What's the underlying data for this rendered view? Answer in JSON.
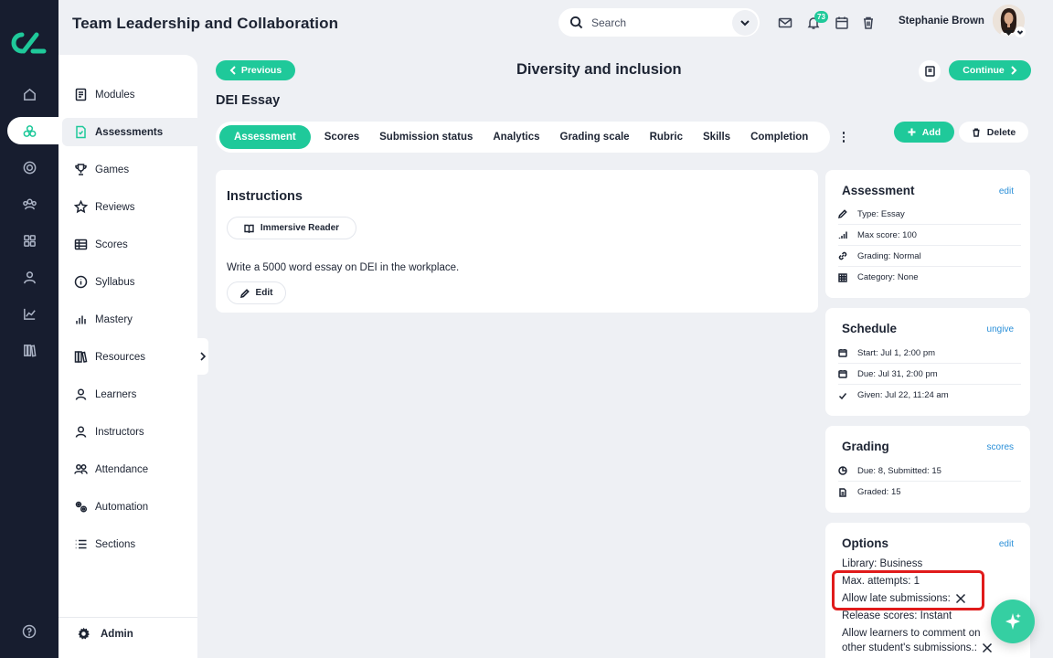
{
  "app": {
    "title": "Team Leadership and Collaboration"
  },
  "search": {
    "placeholder": "Search"
  },
  "notifications": {
    "count": "73"
  },
  "user": {
    "name": "Stephanie Brown"
  },
  "rail_icons": [
    "home-icon",
    "assessments-icon",
    "target-icon",
    "people-icon",
    "grid-icon",
    "user-icon",
    "chart-icon",
    "library-icon"
  ],
  "sidebar": {
    "items": [
      {
        "label": "Modules",
        "icon": "modules-icon"
      },
      {
        "label": "Assessments",
        "icon": "assessment-icon",
        "active": true
      },
      {
        "label": "Games",
        "icon": "trophy-icon"
      },
      {
        "label": "Reviews",
        "icon": "star-icon"
      },
      {
        "label": "Scores",
        "icon": "table-icon"
      },
      {
        "label": "Syllabus",
        "icon": "info-icon"
      },
      {
        "label": "Mastery",
        "icon": "bars-icon"
      },
      {
        "label": "Resources",
        "icon": "books-icon"
      },
      {
        "label": "Learners",
        "icon": "person-icon"
      },
      {
        "label": "Instructors",
        "icon": "instructor-icon"
      },
      {
        "label": "Attendance",
        "icon": "group-icon"
      },
      {
        "label": "Automation",
        "icon": "gears-icon"
      },
      {
        "label": "Sections",
        "icon": "list-icon"
      }
    ],
    "admin_label": "Admin"
  },
  "nav": {
    "previous_label": "Previous",
    "continue_label": "Continue"
  },
  "page": {
    "title": "Diversity and inclusion",
    "subtitle": "DEI Essay"
  },
  "tabs": [
    "Assessment",
    "Scores",
    "Submission status",
    "Analytics",
    "Grading scale",
    "Rubric",
    "Skills",
    "Completion"
  ],
  "actions": {
    "add_label": "Add",
    "delete_label": "Delete"
  },
  "instructions": {
    "heading": "Instructions",
    "reader_label": "Immersive Reader",
    "text": "Write a 5000 word essay on DEI in the workplace.",
    "edit_label": "Edit"
  },
  "assessment_card": {
    "heading": "Assessment",
    "link": "edit",
    "rows": [
      "Type: Essay",
      "Max score: 100",
      "Grading: Normal",
      "Category: None"
    ]
  },
  "schedule_card": {
    "heading": "Schedule",
    "link": "ungive",
    "rows": [
      "Start: Jul 1, 2:00 pm",
      "Due: Jul 31, 2:00 pm",
      "Given: Jul 22, 11:24 am"
    ]
  },
  "grading_card": {
    "heading": "Grading",
    "link": "scores",
    "rows": [
      "Due: 8, Submitted: 15",
      "Graded: 15"
    ]
  },
  "options_card": {
    "heading": "Options",
    "link": "edit",
    "library": "Library: Business",
    "max_attempts": "Max. attempts: 1",
    "late_submissions": "Allow late submissions:",
    "release_scores": "Release scores: Instant",
    "comment_line1": "Allow learners to comment on",
    "comment_line2": "other student's submissions.:"
  },
  "colors": {
    "accent": "#1fc99a",
    "rail": "#171d2f",
    "link": "#2a8fd8",
    "highlight": "#e01b1b"
  }
}
